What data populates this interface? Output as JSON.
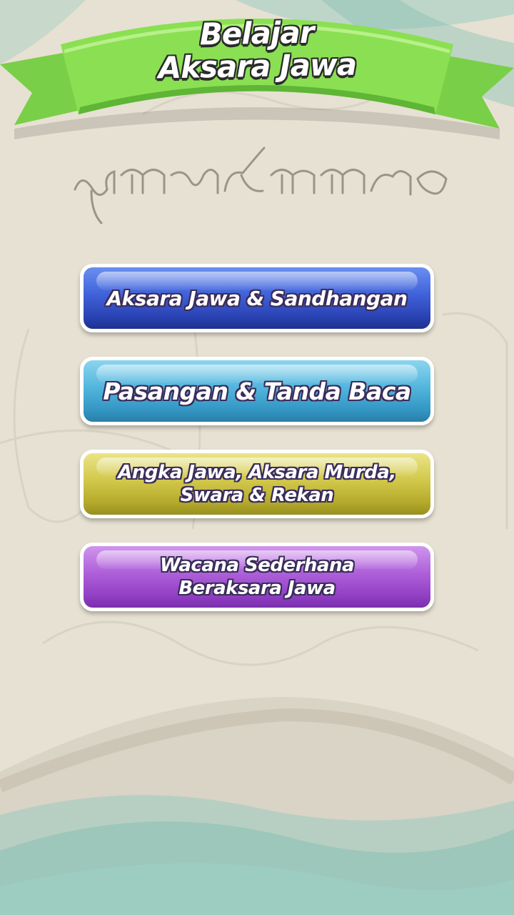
{
  "app": {
    "title_line1": "Belajar",
    "title_line2": "Aksara Jawa"
  },
  "menu": {
    "items": [
      {
        "label_line1": "Aksara Jawa & Sandhangan",
        "label_line2": ""
      },
      {
        "label_line1": "Pasangan & Tanda Baca",
        "label_line2": ""
      },
      {
        "label_line1": "Angka Jawa,  Aksara Murda,",
        "label_line2": "Swara & Rekan"
      },
      {
        "label_line1": "Wacana Sederhana",
        "label_line2": "Beraksara Jawa"
      }
    ]
  },
  "colors": {
    "background": "#e4dfd0",
    "ribbon_green": "#7fd84a",
    "wave_teal": "#8fc9bf",
    "button_blue": "#3f61d9",
    "button_cyan": "#52b5dd",
    "button_olive": "#d1c74a",
    "button_purple": "#ad5fd9"
  },
  "icons": {
    "header": "ribbon-banner",
    "script": "javanese-script-decoration"
  }
}
